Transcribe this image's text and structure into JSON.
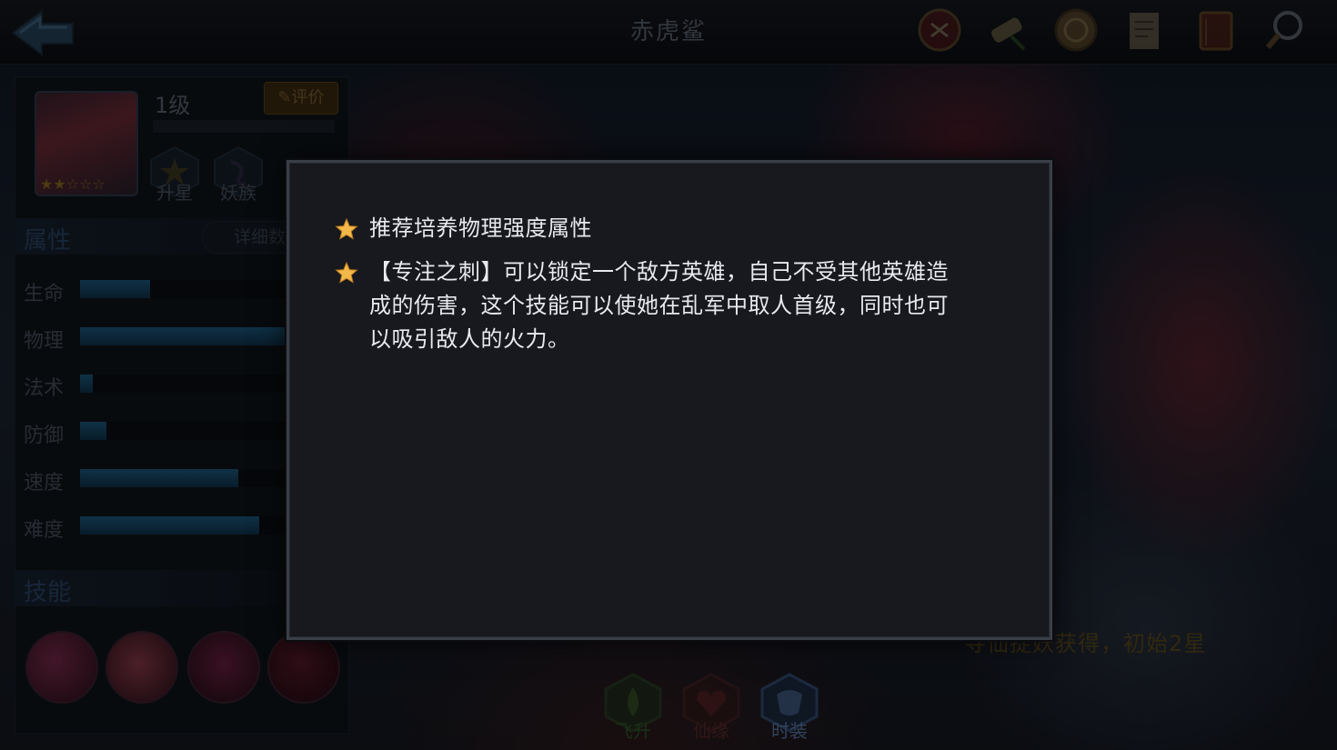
{
  "header": {
    "title": "赤虎鲨",
    "top_icons": [
      "fate-seal-icon",
      "scroll-icon",
      "medal-icon",
      "document-icon",
      "book-icon",
      "magnifier-icon"
    ]
  },
  "hero": {
    "level": "1级",
    "rate_label": "评价",
    "star_count": 2,
    "actions": [
      {
        "label": "升星",
        "icon": "star-up-icon"
      },
      {
        "label": "妖族",
        "icon": "demon-clan-icon"
      }
    ]
  },
  "attributes": {
    "title": "属性",
    "detail_label": "详细数",
    "items": [
      {
        "label": "生命",
        "value": 0.34
      },
      {
        "label": "物理",
        "value": 1.0
      },
      {
        "label": "法术",
        "value": 0.06
      },
      {
        "label": "防御",
        "value": 0.13
      },
      {
        "label": "速度",
        "value": 0.77
      },
      {
        "label": "难度",
        "value": 0.87
      }
    ]
  },
  "skills": {
    "title": "技能",
    "icons": [
      "shark-skill-icon",
      "shark-jaws-skill-icon",
      "dagger-skill-icon",
      "shark-bite-skill-icon"
    ]
  },
  "hint": "寻仙捉妖获得，初始2星",
  "bottom_tabs": [
    {
      "label": "飞升",
      "color": "#2f6b2a"
    },
    {
      "label": "仙缘",
      "color": "#6b2a2a"
    },
    {
      "label": "时装",
      "color": "#2a4a7a"
    }
  ],
  "tips_dialog": {
    "tips": [
      {
        "lines": [
          "推荐培养物理强度属性"
        ]
      },
      {
        "lines": [
          "【专注之刺】可以锁定一个敌方英雄，自己不受其他英雄造",
          "成的伤害，这个技能可以使她在乱军中取人首级，同时也可",
          "以吸引敌人的火力。"
        ]
      }
    ]
  }
}
